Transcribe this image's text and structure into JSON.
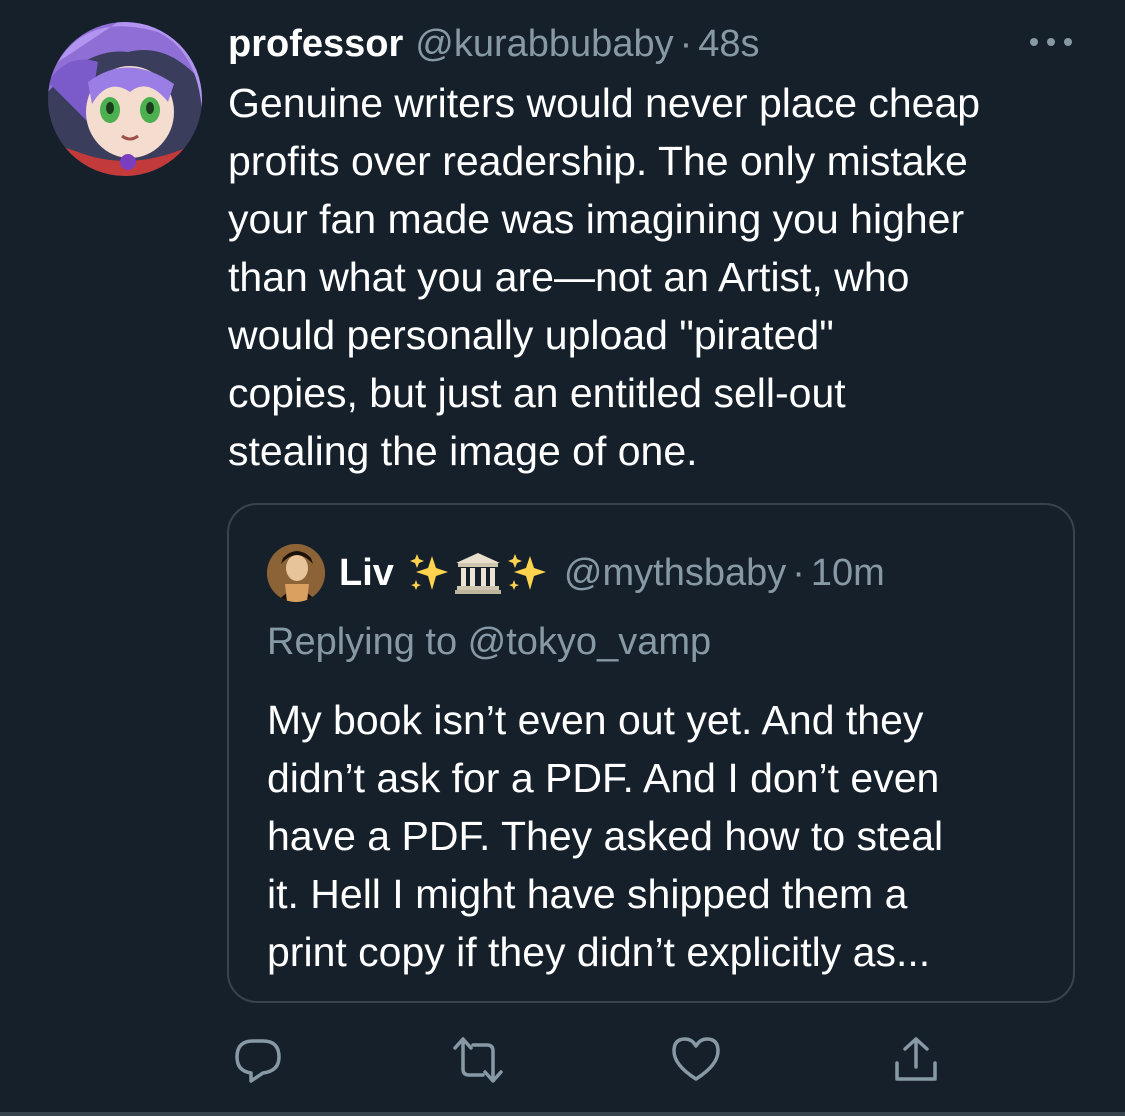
{
  "tweet": {
    "display_name": "professor",
    "handle": "@kurabbubaby",
    "separator": "·",
    "time": "48s",
    "text_lines": [
      "Genuine writers would never place cheap",
      "profits over readership. The only mistake",
      "your fan made was imagining you higher",
      "than what you are—not an Artist, who",
      "would personally upload \"pirated\"",
      "copies, but just an entitled sell-out",
      "stealing the image of one."
    ]
  },
  "quote": {
    "display_name": "Liv",
    "emojis": [
      "sparkles-icon",
      "classical-building-icon",
      "sparkles-icon"
    ],
    "handle": "@mythsbaby",
    "separator": "·",
    "time": "10m",
    "replying_to": "Replying to @tokyo_vamp",
    "text_lines": [
      "My book isn’t even out yet. And they",
      "didn’t ask for a PDF. And I don’t even",
      "have a PDF. They asked how to steal",
      "it. Hell I might have shipped them a",
      "print copy if they didn’t explicitly as..."
    ]
  },
  "actions": [
    "reply-icon",
    "retweet-icon",
    "like-icon",
    "share-icon"
  ],
  "colors": {
    "background": "#15202b",
    "text": "#ffffff",
    "secondary_text": "#8899a6",
    "border": "#38444d",
    "sparkle": "#ffd34d"
  }
}
